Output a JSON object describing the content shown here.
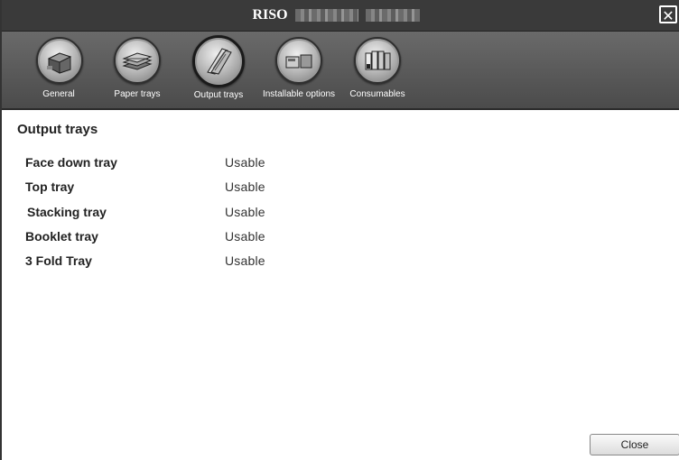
{
  "window": {
    "title": "RISO",
    "close_glyph": "✕"
  },
  "toolbar": {
    "items": [
      {
        "label": "General",
        "icon": "printer-icon"
      },
      {
        "label": "Paper trays",
        "icon": "paper-stack-icon"
      },
      {
        "label": "Output trays",
        "icon": "output-tray-icon",
        "active": true
      },
      {
        "label": "Installable options",
        "icon": "options-icon"
      },
      {
        "label": "Consumables",
        "icon": "ink-cartridges-icon"
      }
    ]
  },
  "main": {
    "title": "Output trays",
    "rows": [
      {
        "name": "Face down tray",
        "value": "Usable"
      },
      {
        "name": "Top tray",
        "value": "Usable"
      },
      {
        "name": "Stacking tray",
        "value": "Usable"
      },
      {
        "name": "Booklet tray",
        "value": "Usable"
      },
      {
        "name": "3 Fold Tray",
        "value": "Usable"
      }
    ],
    "close_label": "Close"
  }
}
